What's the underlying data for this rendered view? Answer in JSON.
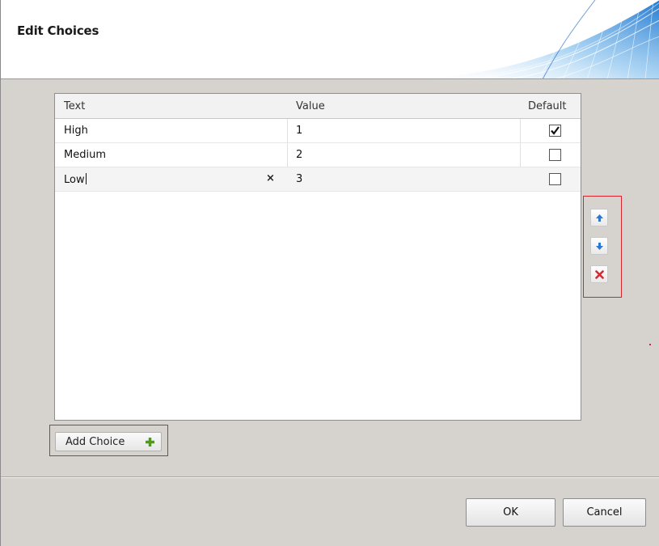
{
  "dialog": {
    "title": "Edit Choices"
  },
  "grid": {
    "columns": [
      "Text",
      "Value",
      "Default"
    ],
    "rows": [
      {
        "text": "High",
        "value": "1",
        "default": true
      },
      {
        "text": "Medium",
        "value": "2",
        "default": false
      },
      {
        "text": "Low",
        "value": "3",
        "default": false
      }
    ],
    "editing_row_index": 2
  },
  "side_buttons": [
    {
      "icon": "arrow-up-icon",
      "color": "#2b77d4"
    },
    {
      "icon": "arrow-down-icon",
      "color": "#2b77d4"
    },
    {
      "icon": "delete-x-icon",
      "color": "#e0262f"
    }
  ],
  "add_choice": {
    "label": "Add Choice",
    "icon": "plus-icon",
    "icon_color": "#4f9a1c"
  },
  "footer": {
    "ok_label": "OK",
    "cancel_label": "Cancel"
  },
  "colors": {
    "highlight": "#d9232f",
    "dialog_background": "#d6d3ce",
    "header_art": "#2f86d8"
  }
}
